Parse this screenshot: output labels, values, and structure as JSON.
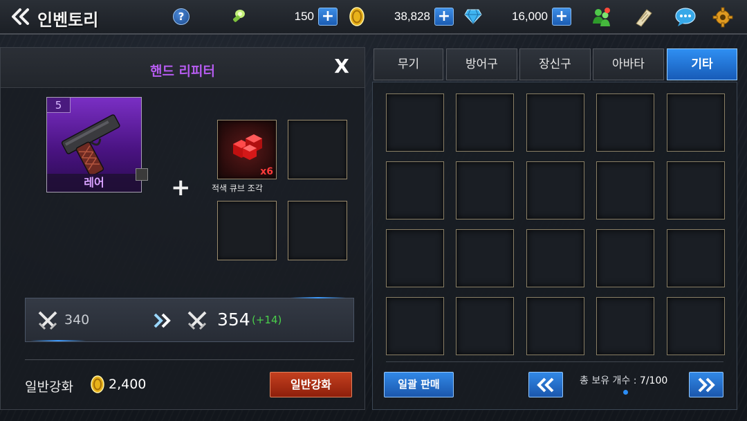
{
  "header": {
    "title": "인벤토리",
    "help_label": "?",
    "energy": {
      "value": "150",
      "icon": "energy-bolt-icon"
    },
    "gold": {
      "value": "38,828",
      "icon": "gold-coin-icon"
    },
    "gems": {
      "value": "16,000",
      "icon": "diamond-gem-icon"
    },
    "plus_label": "+",
    "right_icons": [
      "friends-icon",
      "mail-scroll-icon",
      "chat-bubble-icon",
      "settings-gear-icon"
    ]
  },
  "enhance_panel": {
    "title": "핸드 리피터",
    "close_label": "X",
    "item": {
      "level": "5",
      "rarity": "레어",
      "icon": "pistol-icon"
    },
    "plus": "+",
    "material": {
      "name": "적색 큐브 조각",
      "count": "x6",
      "icon": "red-cube-icon"
    },
    "stat": {
      "current": "340",
      "next": "354",
      "bonus": "(+14)",
      "icon": "crossed-swords-icon"
    },
    "enhance_type_label": "일반강화",
    "cost": "2,400",
    "enhance_button": "일반강화"
  },
  "inventory": {
    "tabs": [
      {
        "label": "무기",
        "active": false
      },
      {
        "label": "방어구",
        "active": false
      },
      {
        "label": "장신구",
        "active": false
      },
      {
        "label": "아바타",
        "active": false
      },
      {
        "label": "기타",
        "active": true
      }
    ],
    "slots": 20,
    "sell_all_button": "일괄 판매",
    "prev_label": "«",
    "next_label": "»",
    "count_label": "총 보유 개수 :",
    "count_value": "7/100"
  },
  "colors": {
    "accent_blue": "#2f8ff2",
    "title_purple": "#b65cf0",
    "enhance_red": "#c4401f",
    "bonus_green": "#4ad04a"
  }
}
